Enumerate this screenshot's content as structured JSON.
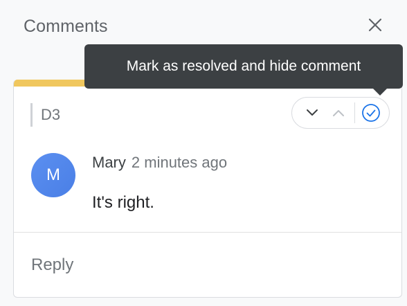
{
  "panel": {
    "title": "Comments",
    "close_icon": "close-icon"
  },
  "comment": {
    "cell_ref": "D3",
    "accent_color": "#f0c75e",
    "actions": {
      "next_icon": "chevron-down-icon",
      "prev_icon": "chevron-up-icon",
      "resolve_icon": "check-circle-icon"
    },
    "author": {
      "initial": "M",
      "name": "Mary",
      "time": "2 minutes ago",
      "avatar_color": "#5b8ff0"
    },
    "text": "It's right.",
    "reply": {
      "placeholder": "Reply",
      "value": ""
    }
  },
  "tooltip": {
    "text": "Mark as resolved and hide comment"
  }
}
